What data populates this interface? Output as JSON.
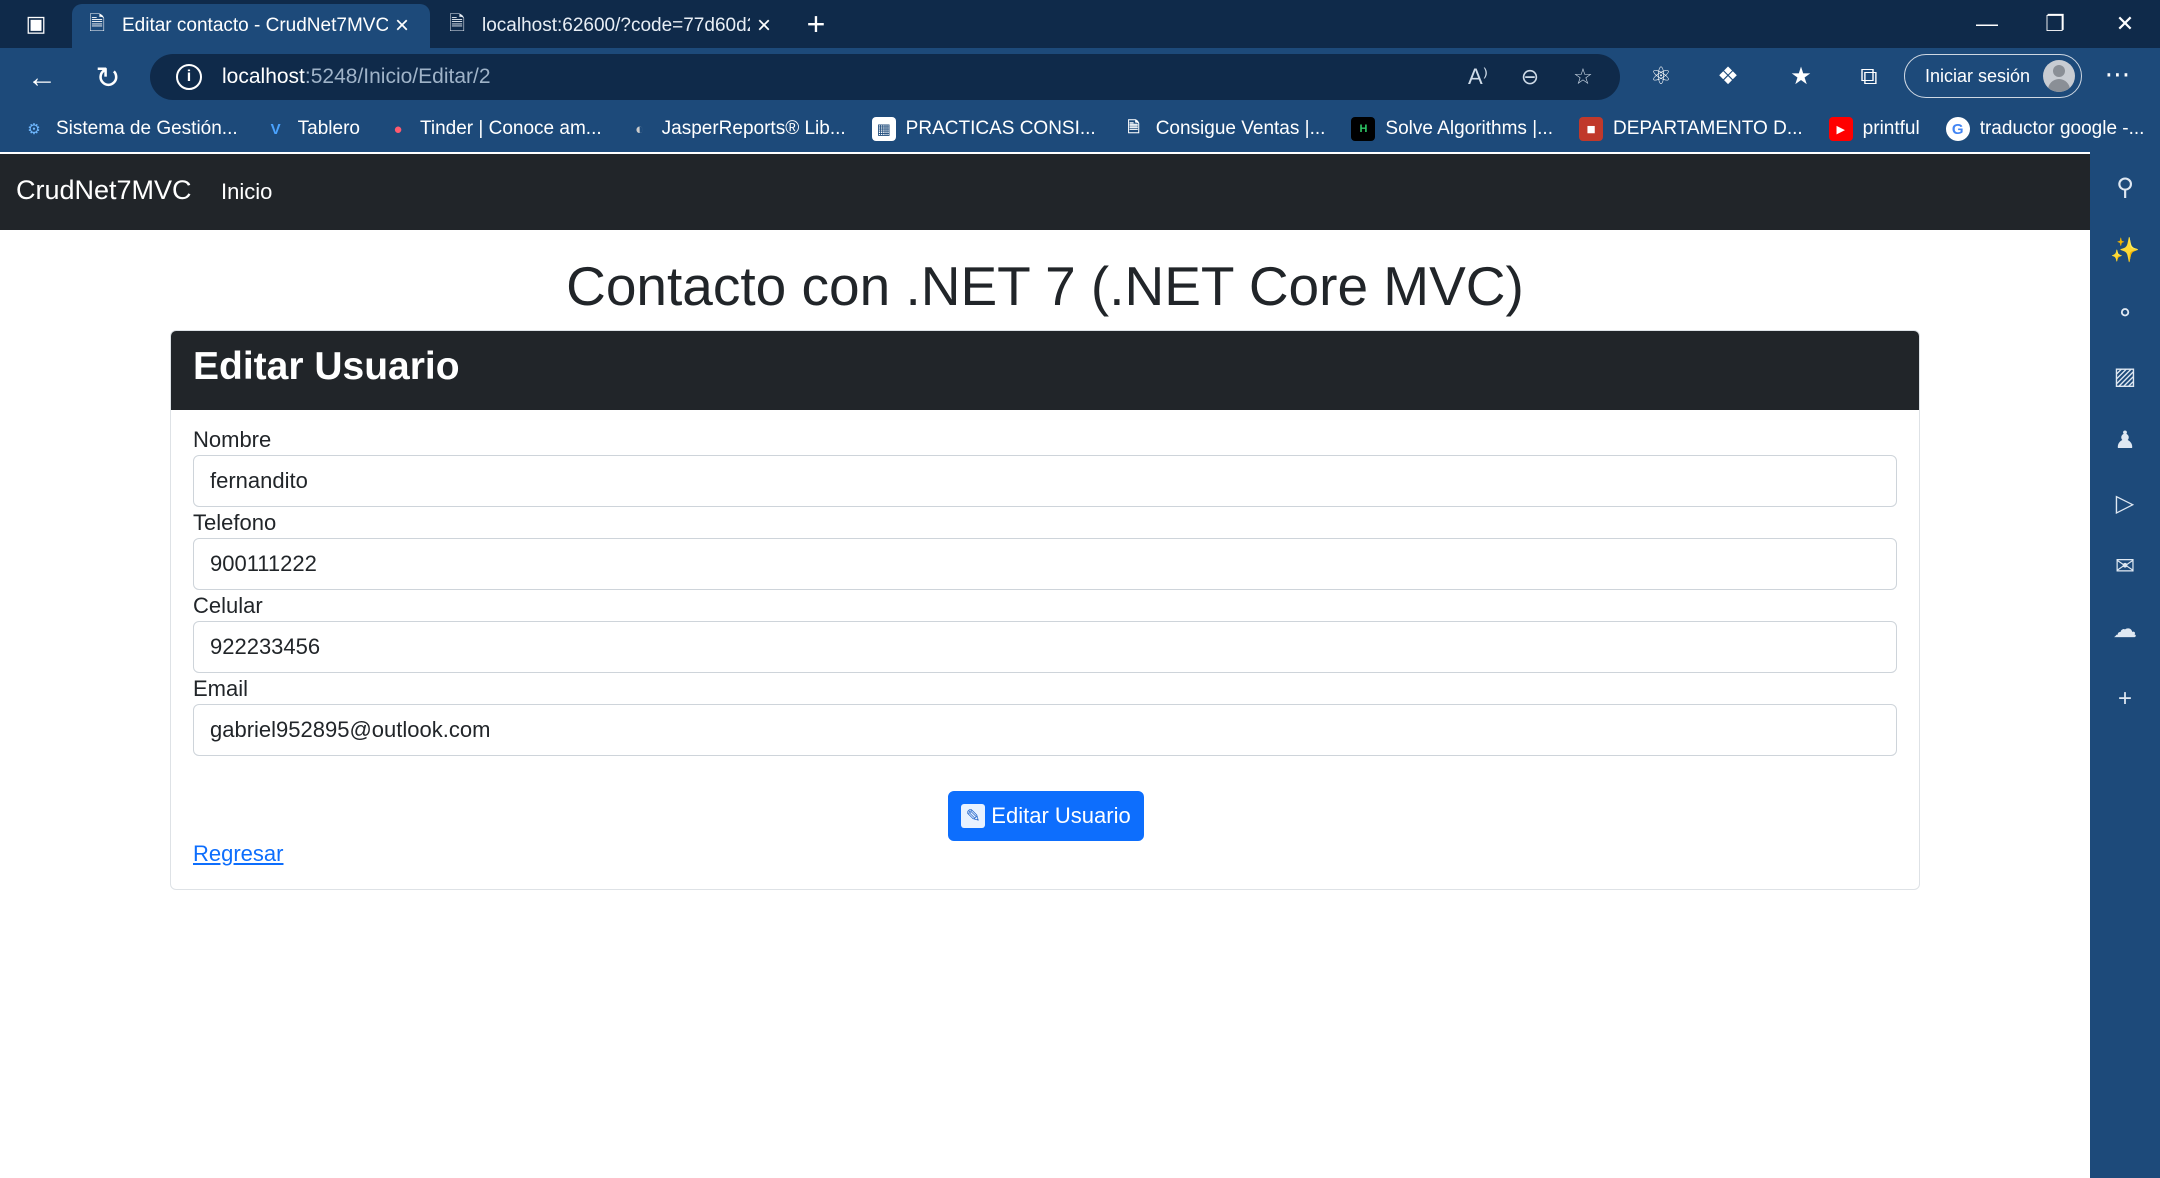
{
  "browser": {
    "tabs": [
      {
        "title": "Editar contacto - CrudNet7MVC",
        "active": true
      },
      {
        "title": "localhost:62600/?code=77d60d2",
        "active": false
      }
    ],
    "address": {
      "host": "localhost",
      "path": ":5248/Inicio/Editar/2"
    },
    "signin_label": "Iniciar sesión",
    "bookmarks": [
      "Sistema de Gestión...",
      "Tablero",
      "Tinder | Conoce am...",
      "JasperReports® Lib...",
      "PRACTICAS CONSI...",
      "Consigue Ventas |...",
      "Solve Algorithms |...",
      "DEPARTAMENTO D...",
      "printful",
      "traductor google -..."
    ]
  },
  "app": {
    "brand": "CrudNet7MVC",
    "nav_link": "Inicio",
    "page_title": "Contacto con .NET 7 (.NET Core MVC)"
  },
  "card": {
    "header": "Editar Usuario",
    "fields": [
      {
        "label": "Nombre",
        "value": "fernandito"
      },
      {
        "label": "Telefono",
        "value": "900111222"
      },
      {
        "label": "Celular",
        "value": "922233456"
      },
      {
        "label": "Email",
        "value": "gabriel952895@outlook.com"
      }
    ],
    "submit_label": "Editar Usuario",
    "back_label": "Regresar"
  },
  "colors": {
    "primary": "#0d6efd",
    "navbar": "#212529",
    "browser_frame": "#1d4a7a",
    "browser_tabbar": "#0f2a4a"
  }
}
